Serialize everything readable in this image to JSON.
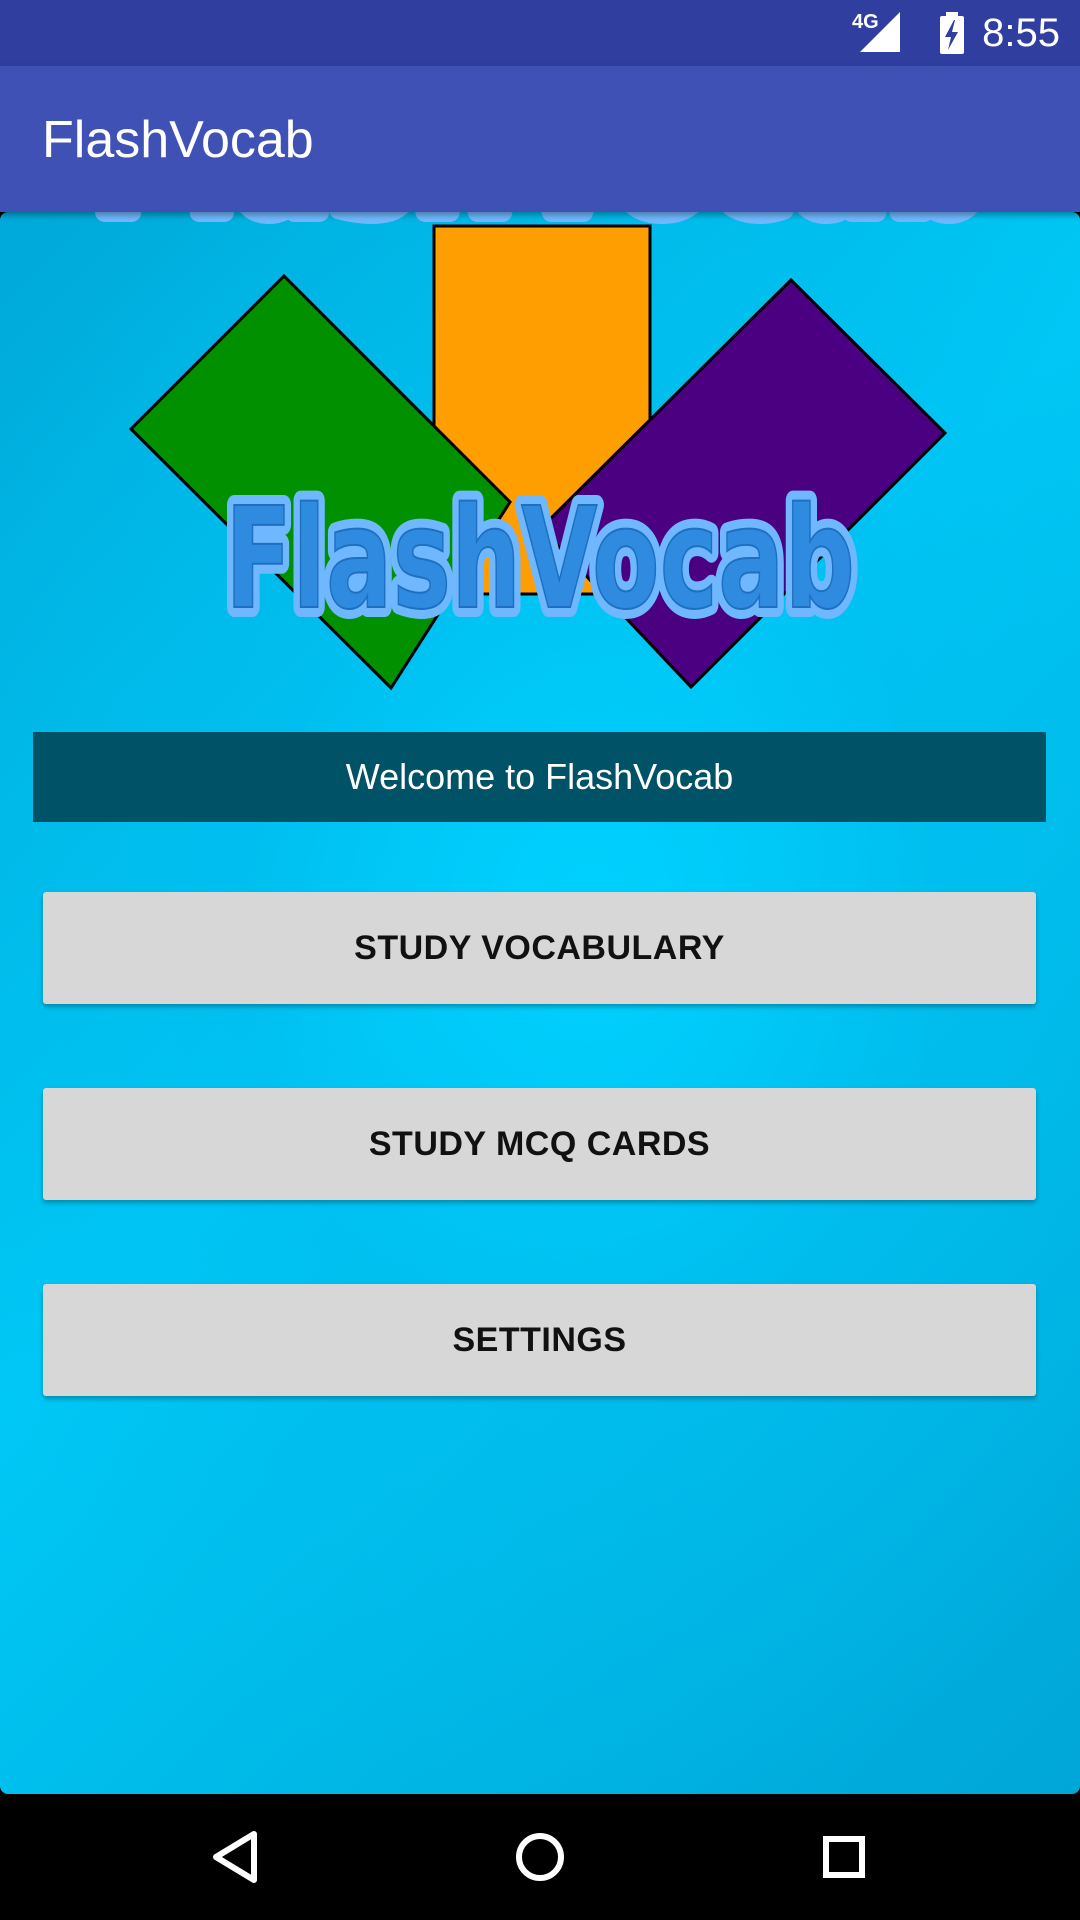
{
  "status_bar": {
    "time": "8:55",
    "network_label": "4G",
    "network_icon": "signal-icon",
    "battery_icon": "battery-charging-icon",
    "background_color": "#303F9F"
  },
  "app_bar": {
    "title": "FlashVocab",
    "background_color": "#3F51B5"
  },
  "logo": {
    "text": "FlashVocab",
    "card_colors": [
      "#009000",
      "#FF9E00",
      "#4A0080"
    ],
    "text_color": "#2E8BE0"
  },
  "welcome_banner": {
    "text": "Welcome to FlashVocab",
    "background_color": "#005266"
  },
  "buttons": {
    "study_vocabulary": "STUDY VOCABULARY",
    "study_mcq_cards": "STUDY MCQ CARDS",
    "settings": "SETTINGS"
  },
  "nav_bar": {
    "back_icon": "back-icon",
    "home_icon": "home-icon",
    "recents_icon": "recents-icon"
  }
}
